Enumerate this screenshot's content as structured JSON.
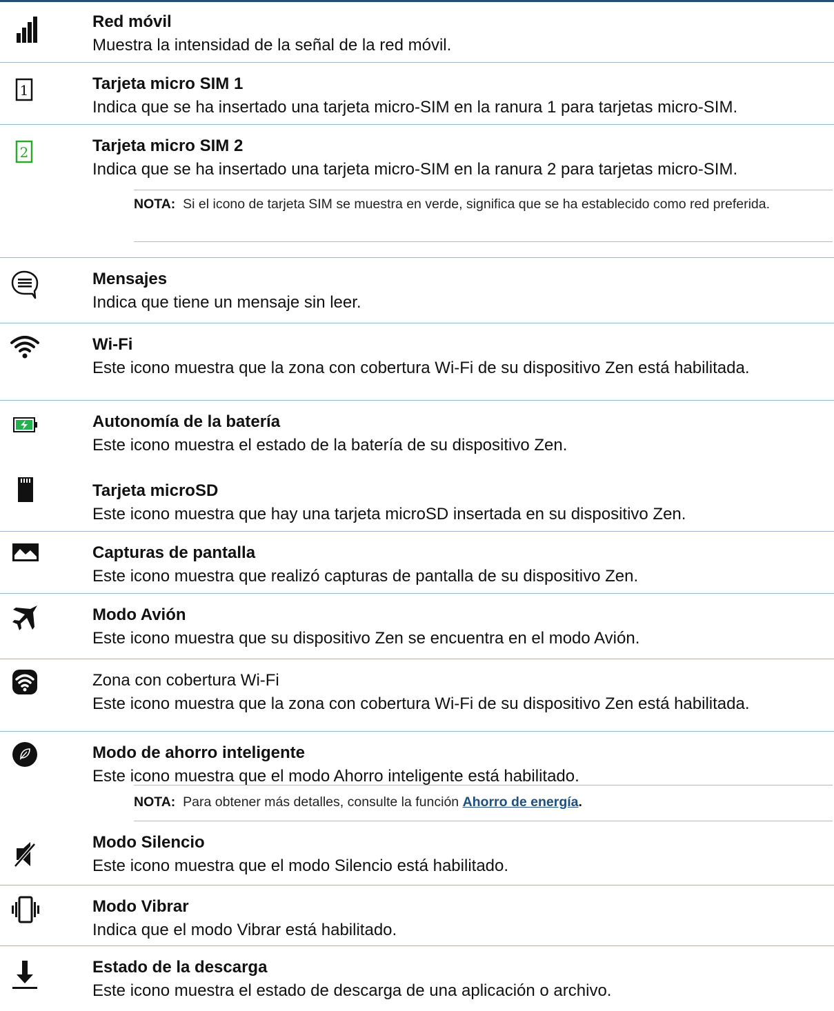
{
  "items": [
    {
      "title": "Red móvil",
      "desc": "Muestra la intensidad de la señal de la red móvil.",
      "icon": "signal-bars-icon"
    },
    {
      "title": "Tarjeta micro SIM 1",
      "desc": "Indica que se ha insertado una tarjeta micro-SIM en la ranura 1 para tarjetas micro-SIM.",
      "icon": "sim1-card-icon"
    },
    {
      "title": "Tarjeta micro SIM 2",
      "desc": "Indica que se ha insertado una tarjeta micro-SIM en la ranura 2 para tarjetas micro-SIM.",
      "icon": "sim2-card-icon"
    },
    {
      "title": "Mensajes",
      "desc": "Indica que tiene un mensaje sin leer.",
      "icon": "message-bubble-icon"
    },
    {
      "title": "Wi-Fi",
      "desc": "Este icono muestra que la zona con cobertura Wi-Fi de su dispositivo Zen está habilitada.",
      "icon": "wifi-icon"
    },
    {
      "title": "Autonomía de la batería",
      "desc": "Este icono muestra el estado de la batería de su dispositivo Zen.",
      "icon": "battery-charging-icon"
    },
    {
      "title": "Tarjeta microSD",
      "desc": "Este icono muestra que hay una tarjeta microSD insertada en su dispositivo Zen.",
      "icon": "microsd-card-icon"
    },
    {
      "title": "Capturas de pantalla",
      "desc": "Este icono muestra que realizó capturas de pantalla de su dispositivo Zen.",
      "icon": "screenshot-image-icon"
    },
    {
      "title": "Modo Avión",
      "desc": "Este icono muestra que su dispositivo Zen se encuentra en el modo Avión.",
      "icon": "airplane-icon"
    },
    {
      "title": "Zona con cobertura Wi-Fi",
      "desc": "Este icono muestra que la zona con cobertura Wi-Fi de su dispositivo Zen está habilitada.",
      "icon": "wifi-hotspot-icon"
    },
    {
      "title": "Modo de ahorro inteligente",
      "desc": "Este icono muestra que el modo Ahorro inteligente está habilitado.",
      "icon": "smart-saving-leaf-icon"
    },
    {
      "title": "Modo Silencio",
      "desc": "Este icono muestra que el modo Silencio está habilitado.",
      "icon": "silent-mode-icon"
    },
    {
      "title": "Modo Vibrar",
      "desc": "Indica que el modo Vibrar está habilitado.",
      "icon": "vibrate-mode-icon"
    },
    {
      "title": "Estado de la descarga",
      "desc": "Este icono muestra el estado de descarga de una aplicación o archivo.",
      "icon": "download-arrow-icon"
    }
  ],
  "notes": {
    "sim": {
      "label": "NOTA:",
      "text": "Si el icono de tarjeta SIM se muestra en verde, significa que se ha establecido como red preferida."
    },
    "saving": {
      "label": "NOTA:",
      "text": "Para obtener más detalles, consulte la función",
      "link": "Ahorro de energía",
      "end": "."
    }
  },
  "colors": {
    "sim2_green": "#2aa82a",
    "battery_green": "#22b14c",
    "divider_blue": "#9bb6cc",
    "link_blue": "#1f4f7a"
  }
}
